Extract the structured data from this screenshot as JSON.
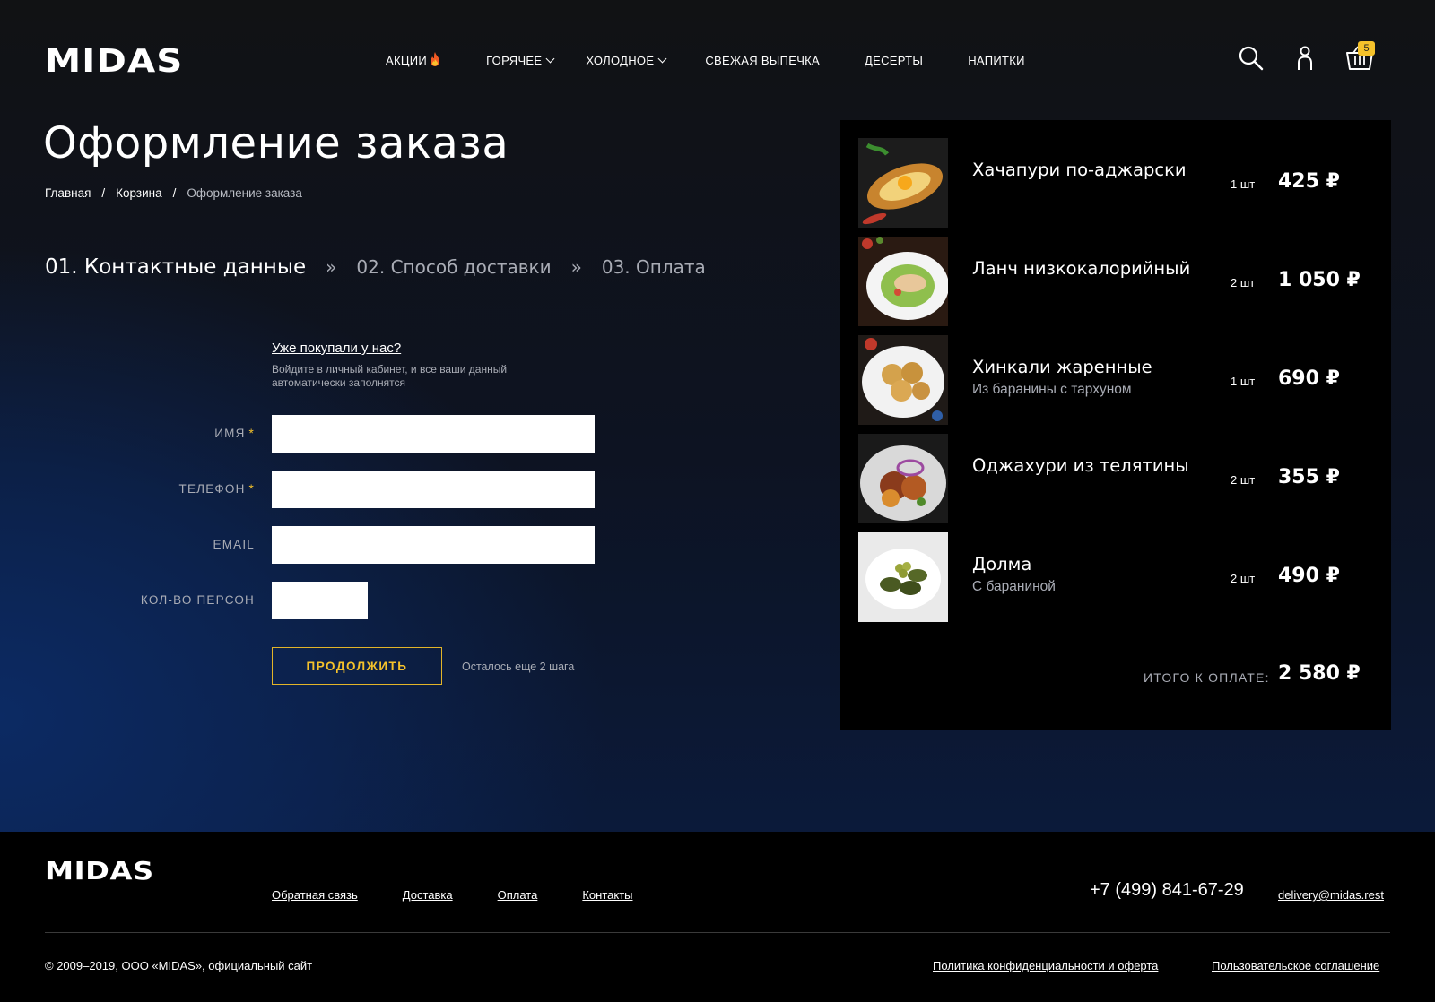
{
  "header": {
    "logo": "MIDAS",
    "nav": [
      {
        "label": "АКЦИИ",
        "fire": true,
        "chevron": false
      },
      {
        "label": "ГОРЯЧЕЕ",
        "fire": false,
        "chevron": true
      },
      {
        "label": "ХОЛОДНОЕ",
        "fire": false,
        "chevron": true
      },
      {
        "label": "СВЕЖАЯ ВЫПЕЧКА",
        "fire": false,
        "chevron": false
      },
      {
        "label": "ДЕСЕРТЫ",
        "fire": false,
        "chevron": false
      },
      {
        "label": "НАПИТКИ",
        "fire": false,
        "chevron": false
      }
    ],
    "icons": [
      "search-icon",
      "user-icon",
      "cart-icon"
    ],
    "cart_count": "5"
  },
  "main": {
    "title": "Оформление заказа",
    "breadcrumb": {
      "home": "Главная",
      "cart": "Корзина",
      "current": "Оформление заказа",
      "separator": "/"
    },
    "steps": {
      "step1": "01. Контактные данные",
      "step2": "02. Способ доставки",
      "step3": "03. Оплата",
      "separator": "»"
    },
    "login_prompt": {
      "link": "Уже покупали у нас?",
      "hint": "Войдите в личный кабинет, и все ваши данный автоматически заполнятся"
    },
    "form": {
      "name_label": "ИМЯ",
      "phone_label": "ТЕЛЕФОН",
      "email_label": "EMAIL",
      "persons_label": "КОЛ-ВО ПЕРСОН",
      "required_mark": "*",
      "name_value": "",
      "phone_value": "",
      "email_value": "",
      "persons_value": ""
    },
    "continue_button": "ПРОДОЛЖИТЬ",
    "steps_left": "Осталось еще 2 шага"
  },
  "cart": {
    "items": [
      {
        "name": "Хачапури по-аджарски",
        "sub": "",
        "qty": "1 шт",
        "price": "425 ₽"
      },
      {
        "name": "Ланч низкокалорийный",
        "sub": "",
        "qty": "2 шт",
        "price": "1 050 ₽"
      },
      {
        "name": "Хинкали жаренные",
        "sub": "Из баранины с тархуном",
        "qty": "1 шт",
        "price": "690 ₽"
      },
      {
        "name": "Оджахури из телятины",
        "sub": "",
        "qty": "2 шт",
        "price": "355 ₽"
      },
      {
        "name": "Долма",
        "sub": "С бараниной",
        "qty": "2 шт",
        "price": "490 ₽"
      }
    ],
    "total_label": "ИТОГО К ОПЛАТЕ:",
    "total_value": "2 580 ₽"
  },
  "footer": {
    "logo": "MIDAS",
    "links": [
      "Обратная связь",
      "Доставка",
      "Оплата",
      "Контакты"
    ],
    "phone": "+7 (499) 841-67-29",
    "email": "delivery@midas.rest",
    "copyright": "© 2009–2019, ООО «MIDAS», официальный сайт",
    "privacy": "Политика конфиденциальности и оферта",
    "agreement": "Пользовательское соглашение"
  },
  "colors": {
    "accent": "#f5c22b",
    "panel": "#000000",
    "muted": "#a9acb5"
  }
}
